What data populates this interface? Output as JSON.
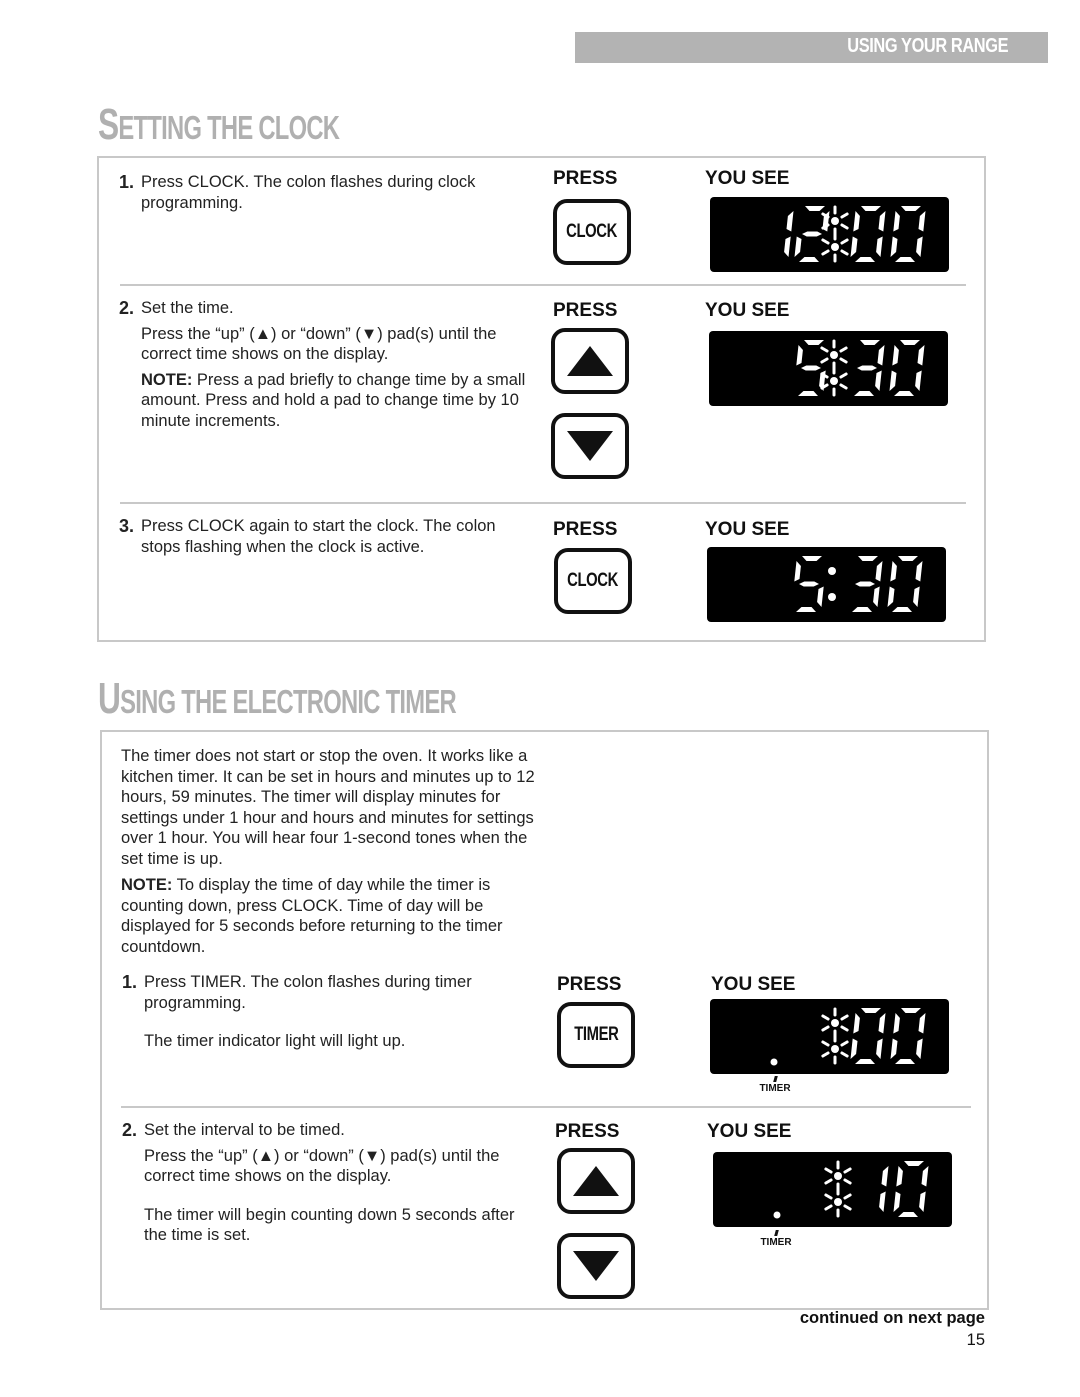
{
  "header": {
    "section": "USING YOUR RANGE"
  },
  "clock_section": {
    "title_first": "S",
    "title_rest": "ETTING THE CLOCK",
    "press_label": "PRESS",
    "you_see_label": "YOU SEE",
    "steps": [
      {
        "number": "1.",
        "text": "Press CLOCK. The colon flashes during clock programming.",
        "pads": [
          "CLOCK"
        ],
        "display": {
          "digits": [
            "1",
            "2",
            "0",
            "0"
          ],
          "colon": "flashing",
          "timer_dot": false
        }
      },
      {
        "number": "2.",
        "text": "Set the time.",
        "text2": "Press the “up” (▲) or “down” (▼) pad(s) until the correct time shows on the display.",
        "note_label": "NOTE:",
        "note": " Press a pad briefly to change time by a small amount. Press and hold a pad to change time by 10 minute increments.",
        "pads": [
          "up",
          "down"
        ],
        "display": {
          "digits": [
            "",
            "5",
            "3",
            "0"
          ],
          "colon": "flashing",
          "timer_dot": false
        }
      },
      {
        "number": "3.",
        "text": "Press CLOCK again to start the clock. The colon stops flashing when the clock is active.",
        "pads": [
          "CLOCK"
        ],
        "display": {
          "digits": [
            "",
            "5",
            "3",
            "0"
          ],
          "colon": "steady",
          "timer_dot": false
        }
      }
    ]
  },
  "timer_section": {
    "title_first": "U",
    "title_rest": "SING THE ELECTRONIC TIMER",
    "intro": "The timer does not start or stop the oven. It works like a kitchen timer. It can be set in hours and minutes up to 12 hours, 59 minutes. The timer will display minutes for settings under 1 hour and hours and minutes for settings over 1 hour. You will hear four 1-second tones when the set time is up.",
    "note_label": "NOTE:",
    "note": " To display the time of day while the timer is counting down, press CLOCK. Time of day will be displayed for 5 seconds before returning to the timer countdown.",
    "press_label": "PRESS",
    "you_see_label": "YOU SEE",
    "indicator_label": "TIMER",
    "steps": [
      {
        "number": "1.",
        "text": "Press TIMER. The colon flashes during timer programming.",
        "text2": "The timer indicator light will light up.",
        "pads": [
          "TIMER"
        ],
        "display": {
          "digits": [
            "",
            "",
            "0",
            "0"
          ],
          "colon": "flashing",
          "timer_dot": true
        }
      },
      {
        "number": "2.",
        "text": "Set the interval to be timed.",
        "text2": "Press the “up” (▲) or “down” (▼) pad(s) until the correct time shows on the display.",
        "text3": "The timer will begin counting down 5 seconds after the time is set.",
        "pads": [
          "up",
          "down"
        ],
        "display": {
          "digits": [
            "",
            "",
            "1",
            "0"
          ],
          "colon": "flashing",
          "timer_dot": true
        }
      }
    ]
  },
  "footer": {
    "continued": "continued on next page",
    "page_number": "15"
  }
}
